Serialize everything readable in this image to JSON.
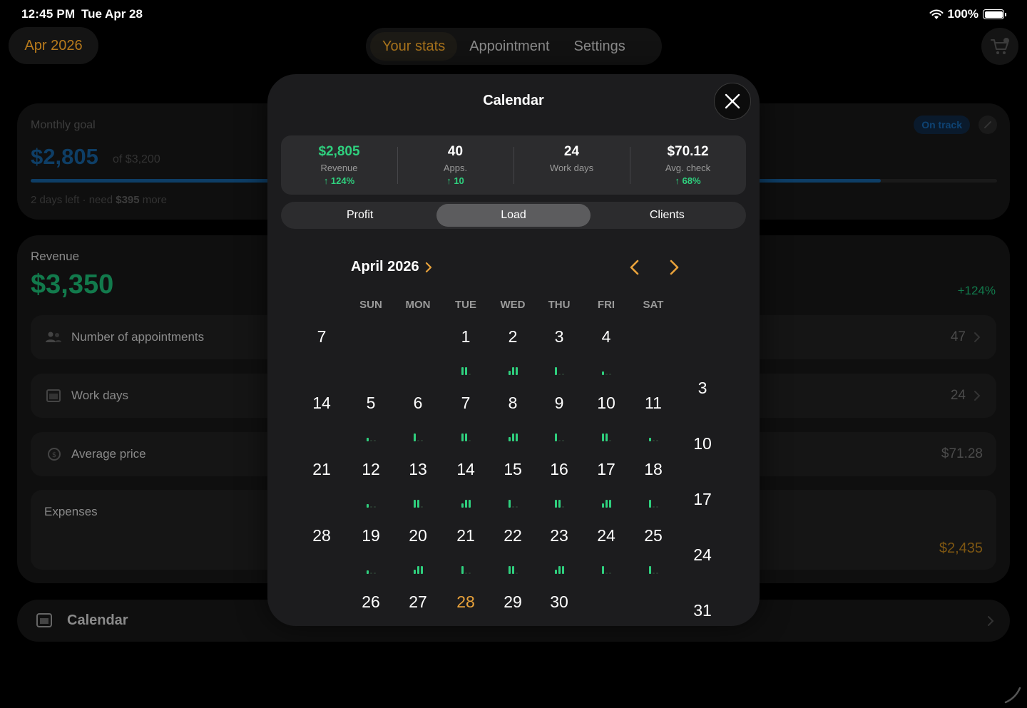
{
  "status_bar": {
    "time": "12:45 PM",
    "date": "Tue Apr 28",
    "battery": "100%"
  },
  "header": {
    "month": "Apr 2026",
    "tabs": [
      "Your stats",
      "Appointment",
      "Settings"
    ],
    "active_tab": "Your stats",
    "cart_icon": "cart-icon"
  },
  "background": {
    "goal": {
      "label": "Monthly goal",
      "amount": "$2,805",
      "of": "of $3,200",
      "progress": 0.88,
      "status": "On track",
      "note_prefix": "2 days left · need",
      "note_amount": "$395",
      "note_suffix": "more"
    },
    "revenue": {
      "label": "Revenue",
      "amount": "$3,350",
      "delta": "+124%",
      "rows": [
        {
          "label": "Number of appointments",
          "value": "47",
          "icon": "people-icon"
        },
        {
          "label": "Work days",
          "value": "24",
          "icon": "calendar-grid-icon"
        },
        {
          "label": "Average price",
          "value": "$71.28",
          "icon": "price-icon"
        }
      ],
      "expenses": {
        "label": "Expenses",
        "value": "$2,435"
      }
    },
    "calendar_row": {
      "label": "Calendar"
    }
  },
  "modal": {
    "title": "Calendar",
    "stats": [
      {
        "value": "$2,805",
        "label": "Revenue",
        "delta": "↑ 124%",
        "highlight": true
      },
      {
        "value": "40",
        "label": "Apps.",
        "delta": "↑ 10",
        "highlight": false
      },
      {
        "value": "24",
        "label": "Work days",
        "delta": "",
        "highlight": false
      },
      {
        "value": "$70.12",
        "label": "Avg. check",
        "delta": "↑ 68%",
        "highlight": false
      }
    ],
    "segments": [
      "Profit",
      "Load",
      "Clients"
    ],
    "active_segment": "Load",
    "month_title": "April 2026",
    "weekdays": [
      "SUN",
      "MON",
      "TUE",
      "WED",
      "THU",
      "FRI",
      "SAT"
    ],
    "accent": "#e9a23b",
    "load_color": "#2fd07e",
    "weeks": [
      [
        {
          "d": "7",
          "ghost": true
        },
        null,
        null,
        {
          "d": "1",
          "load": 2
        },
        {
          "d": "2",
          "load": 3
        },
        {
          "d": "3",
          "load": 1
        },
        {
          "d": "4",
          "load": 0
        }
      ],
      [
        {
          "d": "14",
          "ghost": true
        },
        {
          "d": "5",
          "load": 0
        },
        {
          "d": "6",
          "load": 1
        },
        {
          "d": "7",
          "load": 2
        },
        {
          "d": "8",
          "load": 3
        },
        {
          "d": "9",
          "load": 1
        },
        {
          "d": "10",
          "load": 2
        },
        {
          "d": "11",
          "load": 0
        }
      ],
      [
        {
          "d": "21",
          "ghost": true
        },
        {
          "d": "12",
          "load": 0
        },
        {
          "d": "13",
          "load": 2
        },
        {
          "d": "14",
          "load": 3
        },
        {
          "d": "15",
          "load": 1
        },
        {
          "d": "16",
          "load": 2
        },
        {
          "d": "17",
          "load": 3
        },
        {
          "d": "18",
          "load": 1
        }
      ],
      [
        {
          "d": "28",
          "ghost": true
        },
        {
          "d": "19",
          "load": 0
        },
        {
          "d": "20",
          "load": 3
        },
        {
          "d": "21",
          "load": 1
        },
        {
          "d": "22",
          "load": 2
        },
        {
          "d": "23",
          "load": 3
        },
        {
          "d": "24",
          "load": 1
        },
        {
          "d": "25",
          "load": 1
        }
      ],
      [
        {
          "d": "26"
        },
        {
          "d": "27"
        },
        {
          "d": "28",
          "today": true
        },
        {
          "d": "29"
        },
        {
          "d": "30"
        }
      ]
    ],
    "right_ghost_days": [
      "3",
      "10",
      "17",
      "24",
      "31"
    ]
  }
}
